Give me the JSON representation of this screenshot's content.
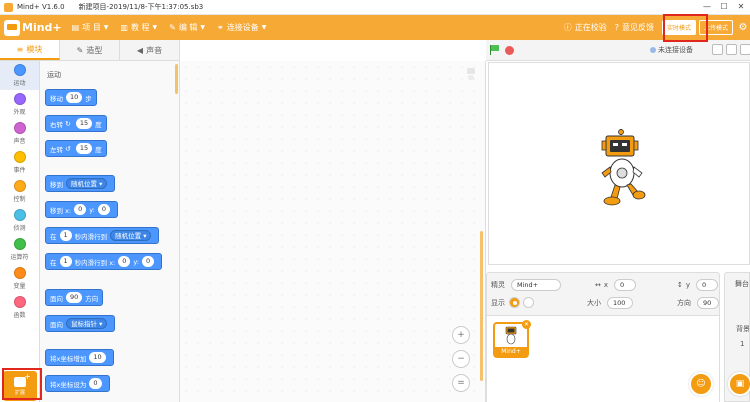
{
  "titlebar": {
    "app_title": "Mind+ V1.6.0",
    "file_title": "新建项目-2019/11/8-下午1:37:05.sb3",
    "minimize": "—",
    "maximize": "☐",
    "close": "✕"
  },
  "menubar": {
    "logo_text": "Mind+",
    "items": [
      {
        "label": "项 目",
        "icon": "file-icon"
      },
      {
        "label": "教 程",
        "icon": "book-icon"
      },
      {
        "label": "编 辑",
        "icon": "edit-icon"
      },
      {
        "label": "连接设备",
        "icon": "connect-icon"
      }
    ],
    "correcting_label": "正在校验",
    "feedback_label": "意见反馈",
    "realtime_mode": "实时模式",
    "upload_mode": "上传模式",
    "accent_color": "#f7a935"
  },
  "tabs": [
    {
      "label": "模块",
      "icon": "blocks-icon"
    },
    {
      "label": "造型",
      "icon": "brush-icon"
    },
    {
      "label": "声音",
      "icon": "speaker-icon"
    }
  ],
  "categories": [
    {
      "label": "运动",
      "color": "#4c97ff"
    },
    {
      "label": "外观",
      "color": "#9966ff"
    },
    {
      "label": "声音",
      "color": "#cf63cf"
    },
    {
      "label": "事件",
      "color": "#ffbf00"
    },
    {
      "label": "控制",
      "color": "#ffab19"
    },
    {
      "label": "侦测",
      "color": "#4cbfe6"
    },
    {
      "label": "运算符",
      "color": "#40bf4a"
    },
    {
      "label": "变量",
      "color": "#ff8c1a"
    },
    {
      "label": "函数",
      "color": "#ff6680"
    }
  ],
  "extension": {
    "label": "扩展"
  },
  "palette": {
    "title": "运动",
    "blocks": {
      "move": {
        "t1": "移动",
        "v": "10",
        "t2": "步"
      },
      "turn_right": {
        "t1": "右转",
        "icon": "↻",
        "v": "15",
        "t2": "度"
      },
      "turn_left": {
        "t1": "左转",
        "icon": "↺",
        "v": "15",
        "t2": "度"
      },
      "goto": {
        "t1": "移到",
        "dd": "随机位置 ▾"
      },
      "goto_xy": {
        "t1": "移到 x:",
        "x": "0",
        "t2": "y:",
        "y": "0"
      },
      "glide": {
        "t1": "在",
        "v": "1",
        "t2": "秒内滑行到",
        "dd": "随机位置 ▾"
      },
      "glide_xy": {
        "t1": "在",
        "v": "1",
        "t2": "秒内滑行到 x:",
        "x": "0",
        "t3": "y:",
        "y": "0"
      },
      "point_dir": {
        "t1": "面向",
        "v": "90",
        "t2": "方向"
      },
      "point_towards": {
        "t1": "面向",
        "dd": "鼠标指针 ▾"
      },
      "change_x": {
        "t1": "将x坐标增加",
        "v": "10"
      },
      "set_x": {
        "t1": "将x坐标设为",
        "v": "0"
      }
    }
  },
  "workspace": {
    "zoom_in": "+",
    "zoom_out": "−",
    "reset": "="
  },
  "stage": {
    "device_status": "未连接设备"
  },
  "sprite_info": {
    "sprite_label": "精灵",
    "sprite_name": "Mind+",
    "x_label": "x",
    "x_value": "0",
    "y_label": "y",
    "y_value": "0",
    "show_label": "显示",
    "size_label": "大小",
    "size_value": "100",
    "direction_label": "方向",
    "direction_value": "90"
  },
  "sprite_list": [
    {
      "name": "Mind+"
    }
  ],
  "stage_side": {
    "title": "舞台",
    "backdrop_label": "背景",
    "backdrop_count": "1"
  }
}
